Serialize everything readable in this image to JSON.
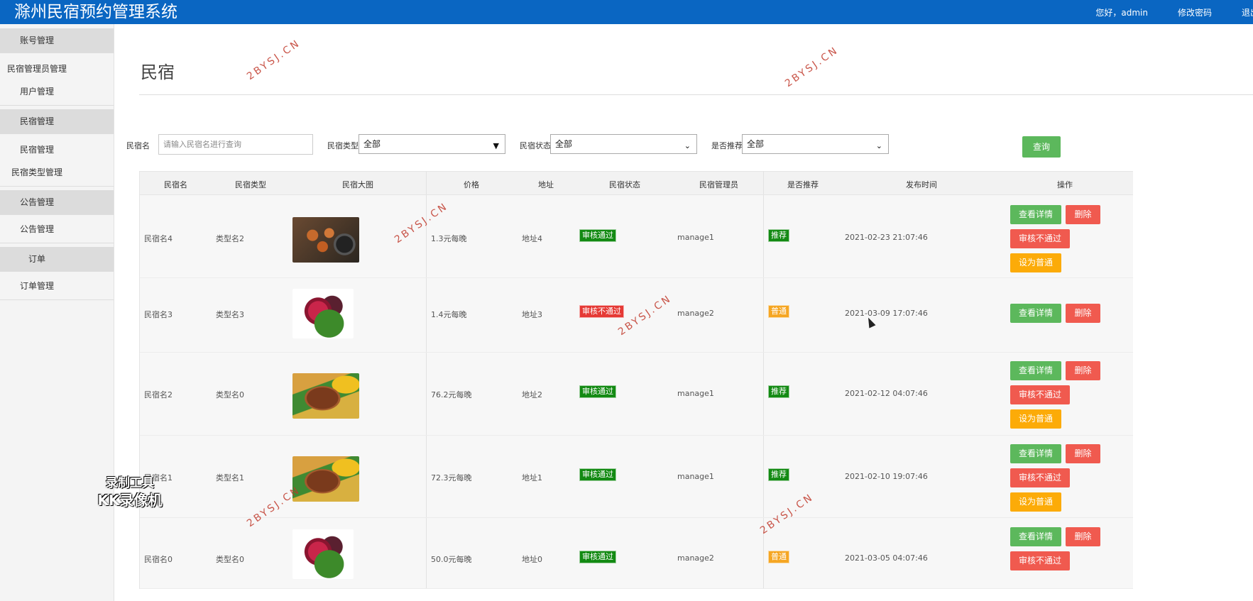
{
  "header": {
    "title": "滁州民宿预约管理系统",
    "greeting": "您好，admin",
    "change_password": "修改密码",
    "logout": "退出"
  },
  "sidebar": {
    "groups": [
      {
        "head": "账号管理",
        "items": [
          "民宿管理员管理",
          "用户管理"
        ]
      },
      {
        "head": "民宿管理",
        "items": [
          "民宿管理",
          "民宿类型管理"
        ]
      },
      {
        "head": "公告管理",
        "items": [
          "公告管理"
        ]
      },
      {
        "head": "订单",
        "items": [
          "订单管理"
        ]
      }
    ]
  },
  "page": {
    "title": "民宿"
  },
  "filters": {
    "name_label": "民宿名",
    "name_placeholder": "请输入民宿名进行查询",
    "type_label": "民宿类型",
    "type_value": "全部",
    "status_label": "民宿状态",
    "status_value": "全部",
    "recommend_label": "是否推荐",
    "recommend_value": "全部",
    "query_label": "查询"
  },
  "table": {
    "headers": [
      "民宿名",
      "民宿类型",
      "民宿大图",
      "价格",
      "地址",
      "民宿状态",
      "民宿管理员",
      "是否推荐",
      "发布时间",
      "操作"
    ],
    "rows": [
      {
        "name": "民宿名4",
        "type": "类型名2",
        "image": "shrimp",
        "price": "1.3元每晚",
        "address": "地址4",
        "status": "审核通过",
        "manager": "manage1",
        "recommend": "推荐",
        "time": "2021-02-23 21:07:46"
      },
      {
        "name": "民宿名3",
        "type": "类型名3",
        "image": "fruit",
        "price": "1.4元每晚",
        "address": "地址3",
        "status": "审核不通过",
        "manager": "manage2",
        "recommend": "普通",
        "time": "2021-03-09 17:07:46"
      },
      {
        "name": "民宿名2",
        "type": "类型名0",
        "image": "meat",
        "price": "76.2元每晚",
        "address": "地址2",
        "status": "审核通过",
        "manager": "manage1",
        "recommend": "推荐",
        "time": "2021-02-12 04:07:46"
      },
      {
        "name": "民宿名1",
        "type": "类型名1",
        "image": "meat",
        "price": "72.3元每晚",
        "address": "地址1",
        "status": "审核通过",
        "manager": "manage1",
        "recommend": "推荐",
        "time": "2021-02-10 19:07:46"
      },
      {
        "name": "民宿名0",
        "type": "类型名0",
        "image": "fruit",
        "price": "50.0元每晚",
        "address": "地址0",
        "status": "审核通过",
        "manager": "manage2",
        "recommend": "普通",
        "time": "2021-03-05 04:07:46"
      }
    ],
    "actions": {
      "view": "查看详情",
      "delete": "删除",
      "reject": "审核不通过",
      "set_normal": "设为普通"
    }
  },
  "watermark": "2BYSJ.CN",
  "recorder": {
    "line1": "录制工具",
    "line2": "KK录像机"
  },
  "colors": {
    "header_bg": "#0a66c2",
    "green": "#5cb85c",
    "red": "#f05a4f",
    "orange": "#fcab08",
    "status_green": "#138a13"
  }
}
